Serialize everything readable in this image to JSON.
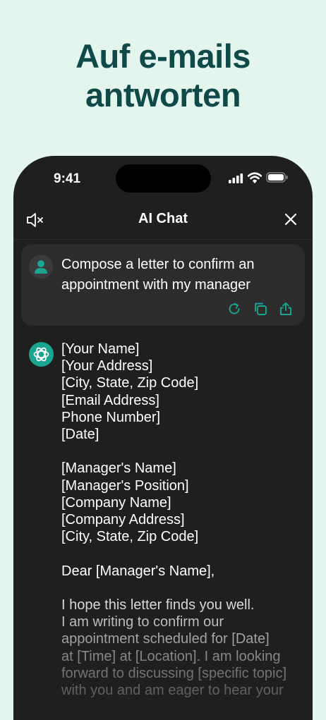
{
  "headline": {
    "line1": "Auf e-mails",
    "line2": "antworten"
  },
  "status_bar": {
    "time": "9:41",
    "icons": [
      "signal-icon",
      "wifi-icon",
      "battery-icon"
    ]
  },
  "nav": {
    "title": "AI Chat",
    "left_icon": "speaker-muted-icon",
    "right_icon": "close-icon"
  },
  "prompt": {
    "text": "Compose a letter to confirm an appointment with my manager",
    "actions": [
      "regenerate-icon",
      "copy-icon",
      "share-icon"
    ]
  },
  "answer": {
    "lines": [
      "[Your Name]",
      "[Your Address]",
      "[City, State, Zip Code]",
      "[Email Address]",
      "Phone Number]",
      "[Date]",
      "",
      "[Manager's Name]",
      "[Manager's Position]",
      "[Company Name]",
      "[Company Address]",
      "[City, State, Zip Code]",
      "",
      "Dear [Manager's Name],",
      "",
      "I hope this letter finds you well.",
      "I am writing to confirm our",
      "appointment scheduled for [Date]",
      "at [Time] at [Location]. I am looking",
      "forward to discussing [specific topic]",
      "with you and am eager to hear your"
    ]
  },
  "colors": {
    "background": "#e3f5ec",
    "headline": "#0f4a48",
    "accent": "#19a58f",
    "panel": "#1f1f1f",
    "card": "#2c2c2c"
  }
}
